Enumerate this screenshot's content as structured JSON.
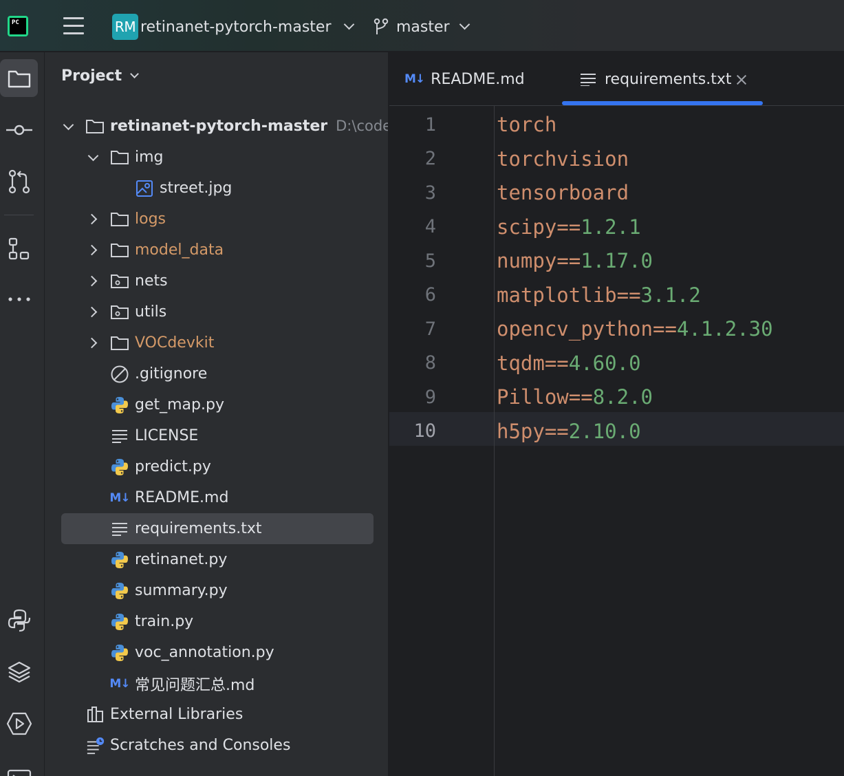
{
  "titlebar": {
    "logo_text": "PC",
    "project_badge": "RM",
    "project_name": "retinanet-pytorch-master",
    "branch": "master"
  },
  "project_panel": {
    "title": "Project",
    "root": {
      "name": "retinanet-pytorch-master",
      "path": "D:\\code\\re"
    },
    "items": [
      {
        "name": "img",
        "type": "folder",
        "expanded": true
      },
      {
        "name": "street.jpg",
        "type": "image"
      },
      {
        "name": "logs",
        "type": "folder",
        "excluded": true
      },
      {
        "name": "model_data",
        "type": "folder",
        "excluded": true
      },
      {
        "name": "nets",
        "type": "package"
      },
      {
        "name": "utils",
        "type": "package"
      },
      {
        "name": "VOCdevkit",
        "type": "folder",
        "excluded": true
      },
      {
        "name": ".gitignore",
        "type": "ignore"
      },
      {
        "name": "get_map.py",
        "type": "python"
      },
      {
        "name": "LICENSE",
        "type": "text"
      },
      {
        "name": "predict.py",
        "type": "python"
      },
      {
        "name": "README.md",
        "type": "markdown"
      },
      {
        "name": "requirements.txt",
        "type": "text",
        "selected": true
      },
      {
        "name": "retinanet.py",
        "type": "python"
      },
      {
        "name": "summary.py",
        "type": "python"
      },
      {
        "name": "train.py",
        "type": "python"
      },
      {
        "name": "voc_annotation.py",
        "type": "python"
      },
      {
        "name": "常见问题汇总.md",
        "type": "markdown"
      }
    ],
    "external_libraries": "External Libraries",
    "scratches": "Scratches and Consoles"
  },
  "editor": {
    "tabs": [
      {
        "label": "README.md",
        "icon": "markdown-icon",
        "icon_text": "M↓",
        "active": false
      },
      {
        "label": "requirements.txt",
        "icon": "text-file-icon",
        "active": true
      }
    ],
    "current_line": 10,
    "lines": [
      {
        "num": "1",
        "pkg": "torch",
        "op": "",
        "ver": ""
      },
      {
        "num": "2",
        "pkg": "torchvision",
        "op": "",
        "ver": ""
      },
      {
        "num": "3",
        "pkg": "tensorboard",
        "op": "",
        "ver": ""
      },
      {
        "num": "4",
        "pkg": "scipy",
        "op": "==",
        "ver": "1.2.1"
      },
      {
        "num": "5",
        "pkg": "numpy",
        "op": "==",
        "ver": "1.17.0"
      },
      {
        "num": "6",
        "pkg": "matplotlib",
        "op": "==",
        "ver": "3.1.2"
      },
      {
        "num": "7",
        "pkg": "opencv_python",
        "op": "==",
        "ver": "4.1.2.30"
      },
      {
        "num": "8",
        "pkg": "tqdm",
        "op": "==",
        "ver": "4.60.0"
      },
      {
        "num": "9",
        "pkg": "Pillow",
        "op": "==",
        "ver": "8.2.0"
      },
      {
        "num": "10",
        "pkg": "h5py",
        "op": "==",
        "ver": "2.10.0"
      }
    ]
  },
  "colors": {
    "accent": "#3574f0",
    "package_name": "#cf8e6d",
    "version": "#6aab73",
    "excluded_folder": "#d59a68"
  }
}
